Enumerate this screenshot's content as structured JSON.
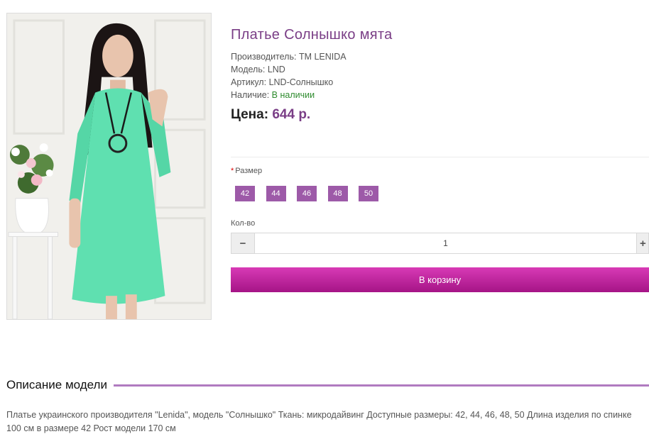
{
  "product": {
    "title": "Платье Солнышко мята",
    "manufacturer_label": "Производитель:",
    "manufacturer_value": "TM LENIDA",
    "model_label": "Модель:",
    "model_value": "LND",
    "article_label": "Артикул:",
    "article_value": "LND-Солнышко",
    "availability_label": "Наличие:",
    "availability_value": "В наличии",
    "price_label": "Цена:",
    "price_value": "644 р."
  },
  "options": {
    "size_label": "Размер",
    "required_mark": "*",
    "sizes": [
      "42",
      "44",
      "46",
      "48",
      "50"
    ]
  },
  "quantity": {
    "label": "Кол-во",
    "minus": "−",
    "value": "1",
    "plus": "+"
  },
  "cart_button": "В корзину",
  "description": {
    "title": "Описание модели",
    "text": "Платье украинского производителя \"Lenida\", модель \"Солнышко\" Ткань: микродайвинг Доступные размеры: 42, 44, 46, 48, 50 Длина изделия по спинке 100 см в размере 42 Рост модели 170 см"
  },
  "colors": {
    "accent": "#7a3e86",
    "size_chip": "#9d5aa8",
    "cart_button": "#c0229f",
    "in_stock": "#2e8b2e",
    "dress": "#5fe0b0"
  }
}
